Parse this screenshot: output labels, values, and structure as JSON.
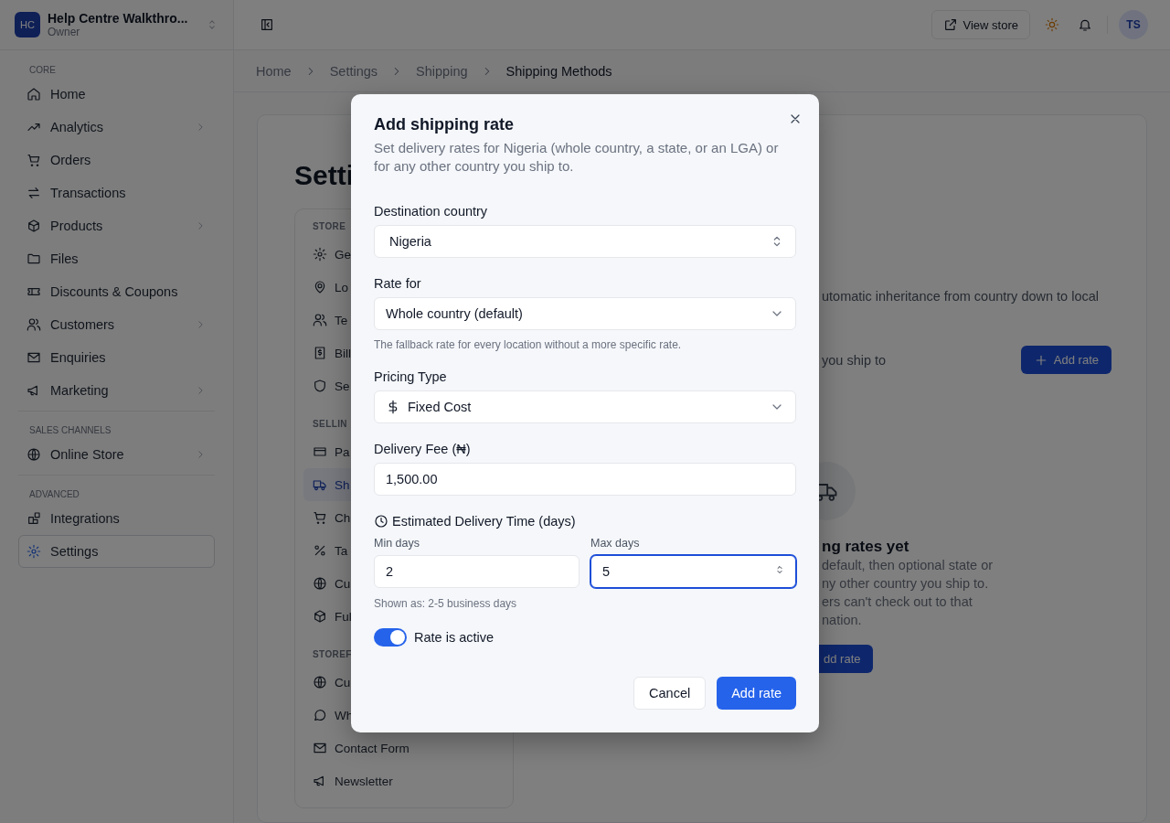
{
  "sidebar": {
    "workspace": {
      "initials": "HC",
      "name": "Help Centre Walkthro...",
      "role": "Owner"
    },
    "sections": [
      {
        "heading": "CORE",
        "items": [
          {
            "label": "Home",
            "has_submenu": false,
            "selected": false
          },
          {
            "label": "Analytics",
            "has_submenu": true,
            "selected": false
          },
          {
            "label": "Orders",
            "has_submenu": false,
            "selected": false
          },
          {
            "label": "Transactions",
            "has_submenu": false,
            "selected": false
          },
          {
            "label": "Products",
            "has_submenu": true,
            "selected": false
          },
          {
            "label": "Files",
            "has_submenu": false,
            "selected": false
          },
          {
            "label": "Discounts & Coupons",
            "has_submenu": false,
            "selected": false
          },
          {
            "label": "Customers",
            "has_submenu": true,
            "selected": false
          },
          {
            "label": "Enquiries",
            "has_submenu": false,
            "selected": false
          },
          {
            "label": "Marketing",
            "has_submenu": true,
            "selected": false
          }
        ]
      },
      {
        "heading": "SALES CHANNELS",
        "items": [
          {
            "label": "Online Store",
            "has_submenu": true,
            "selected": false
          }
        ]
      },
      {
        "heading": "ADVANCED",
        "items": [
          {
            "label": "Integrations",
            "has_submenu": false,
            "selected": false
          },
          {
            "label": "Settings",
            "has_submenu": false,
            "selected": true
          }
        ]
      }
    ]
  },
  "topbar": {
    "view_store": "View store",
    "avatar": "TS"
  },
  "breadcrumb": [
    {
      "label": "Home",
      "current": false
    },
    {
      "label": "Settings",
      "current": false
    },
    {
      "label": "Shipping",
      "current": false
    },
    {
      "label": "Shipping Methods",
      "current": true
    }
  ],
  "page": {
    "title": "Setti",
    "settings_nav": [
      {
        "heading": "STORE",
        "items": [
          {
            "label": "Ge",
            "selected": false
          },
          {
            "label": "Lo",
            "selected": false
          },
          {
            "label": "Te",
            "selected": false
          },
          {
            "label": "Bill",
            "selected": false
          },
          {
            "label": "Se",
            "selected": false
          }
        ]
      },
      {
        "heading": "SELLIN",
        "items": [
          {
            "label": "Pa",
            "selected": false
          },
          {
            "label": "Sh",
            "selected": true
          },
          {
            "label": "Ch",
            "selected": false
          },
          {
            "label": "Ta",
            "selected": false
          },
          {
            "label": "Cu",
            "selected": false
          },
          {
            "label": "Ful",
            "selected": false
          }
        ]
      },
      {
        "heading": "STOREF",
        "items": [
          {
            "label": "Cu",
            "selected": false
          },
          {
            "label": "Wh",
            "selected": false
          },
          {
            "label": "Contact Form",
            "selected": false
          },
          {
            "label": "Newsletter",
            "selected": false
          }
        ]
      }
    ],
    "panel": {
      "description": "utomatic inheritance from country down to local",
      "caption": "you ship to",
      "add_rate": "Add rate",
      "empty_title": "ng rates yet",
      "empty_lines": [
        "default, then optional state or",
        "ny other country you ship to.",
        "ers can't check out to that",
        "nation."
      ],
      "empty_button": "dd rate"
    }
  },
  "dialog": {
    "title": "Add shipping rate",
    "description": "Set delivery rates for Nigeria (whole country, a state, or an LGA) or for any other country you ship to.",
    "destination": {
      "label": "Destination country",
      "value": "Nigeria"
    },
    "rate_for": {
      "label": "Rate for",
      "value": "Whole country (default)",
      "hint": "The fallback rate for every location without a more specific rate."
    },
    "pricing_type": {
      "label": "Pricing Type",
      "value": "Fixed Cost"
    },
    "delivery_fee": {
      "label": "Delivery Fee (₦)",
      "value": "1,500.00"
    },
    "delivery_time": {
      "label": "Estimated Delivery Time (days)",
      "min": {
        "label": "Min days",
        "value": "2",
        "focused": false
      },
      "max": {
        "label": "Max days",
        "value": "5",
        "focused": true
      },
      "hint": "Shown as: 2-5 business days"
    },
    "active": {
      "label": "Rate is active",
      "on": true
    },
    "buttons": {
      "cancel": "Cancel",
      "submit": "Add rate"
    }
  }
}
